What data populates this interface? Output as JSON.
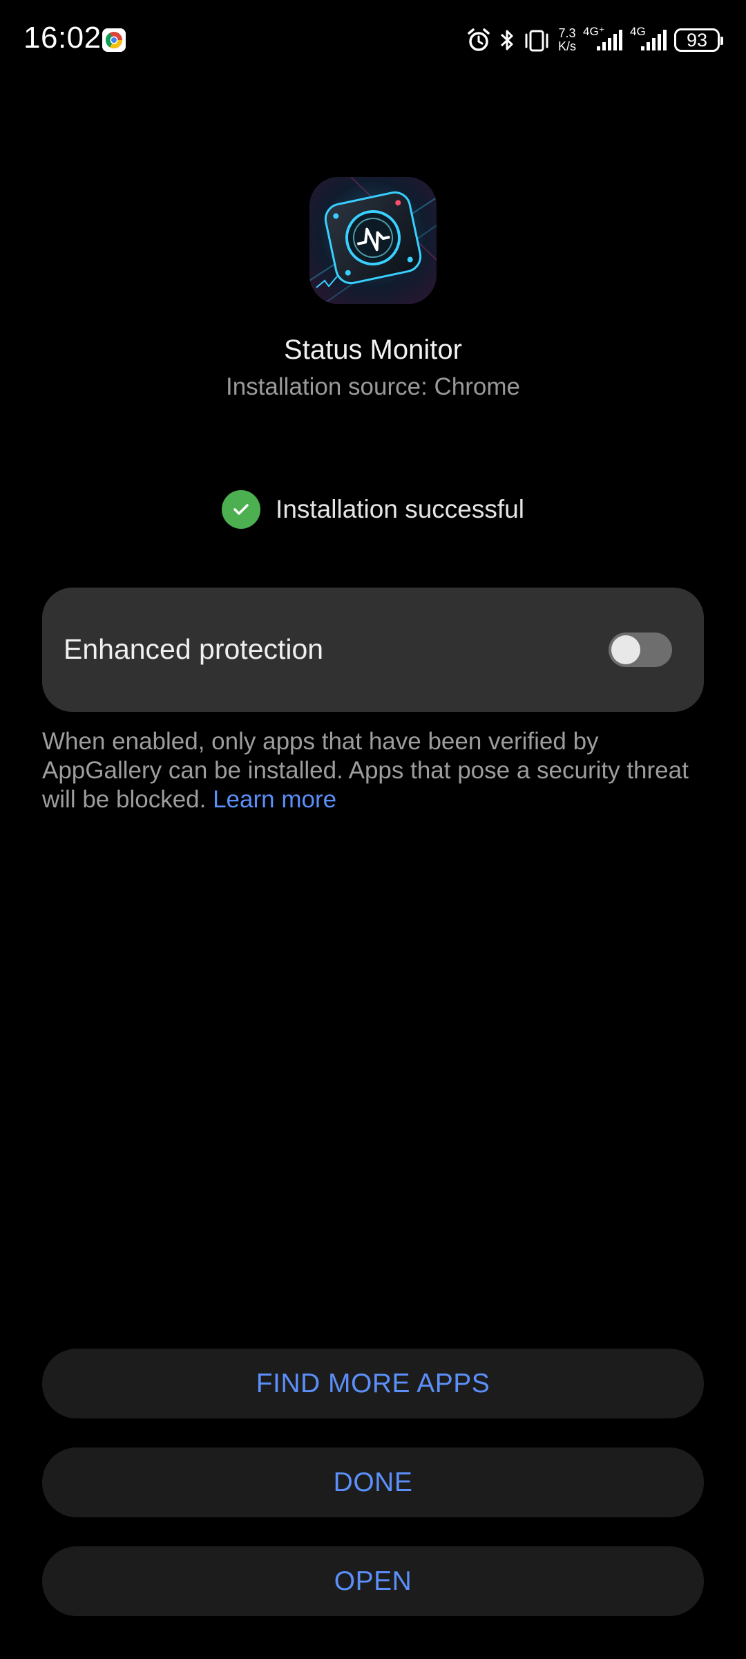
{
  "status_bar": {
    "time": "16:02",
    "net_speed_value": "7.3",
    "net_speed_unit": "K/s",
    "sim1_label": "4G⁺",
    "sim2_label": "4G",
    "battery": "93"
  },
  "app": {
    "name": "Status Monitor",
    "install_source": "Installation source: Chrome",
    "icon": "app-icon"
  },
  "status": {
    "message": "Installation successful",
    "icon": "check-circle-icon",
    "color": "#4caf50"
  },
  "protection": {
    "label": "Enhanced protection",
    "enabled": false,
    "description": "When enabled, only apps that have been verified by AppGallery can be installed. Apps that pose a security threat will be blocked. ",
    "learn_more": "Learn more"
  },
  "buttons": {
    "find_more": "FIND MORE APPS",
    "done": "DONE",
    "open": "OPEN"
  },
  "colors": {
    "accent": "#5b8ff9",
    "background": "#000000",
    "card": "#313131",
    "button_bg": "#1c1c1c"
  }
}
